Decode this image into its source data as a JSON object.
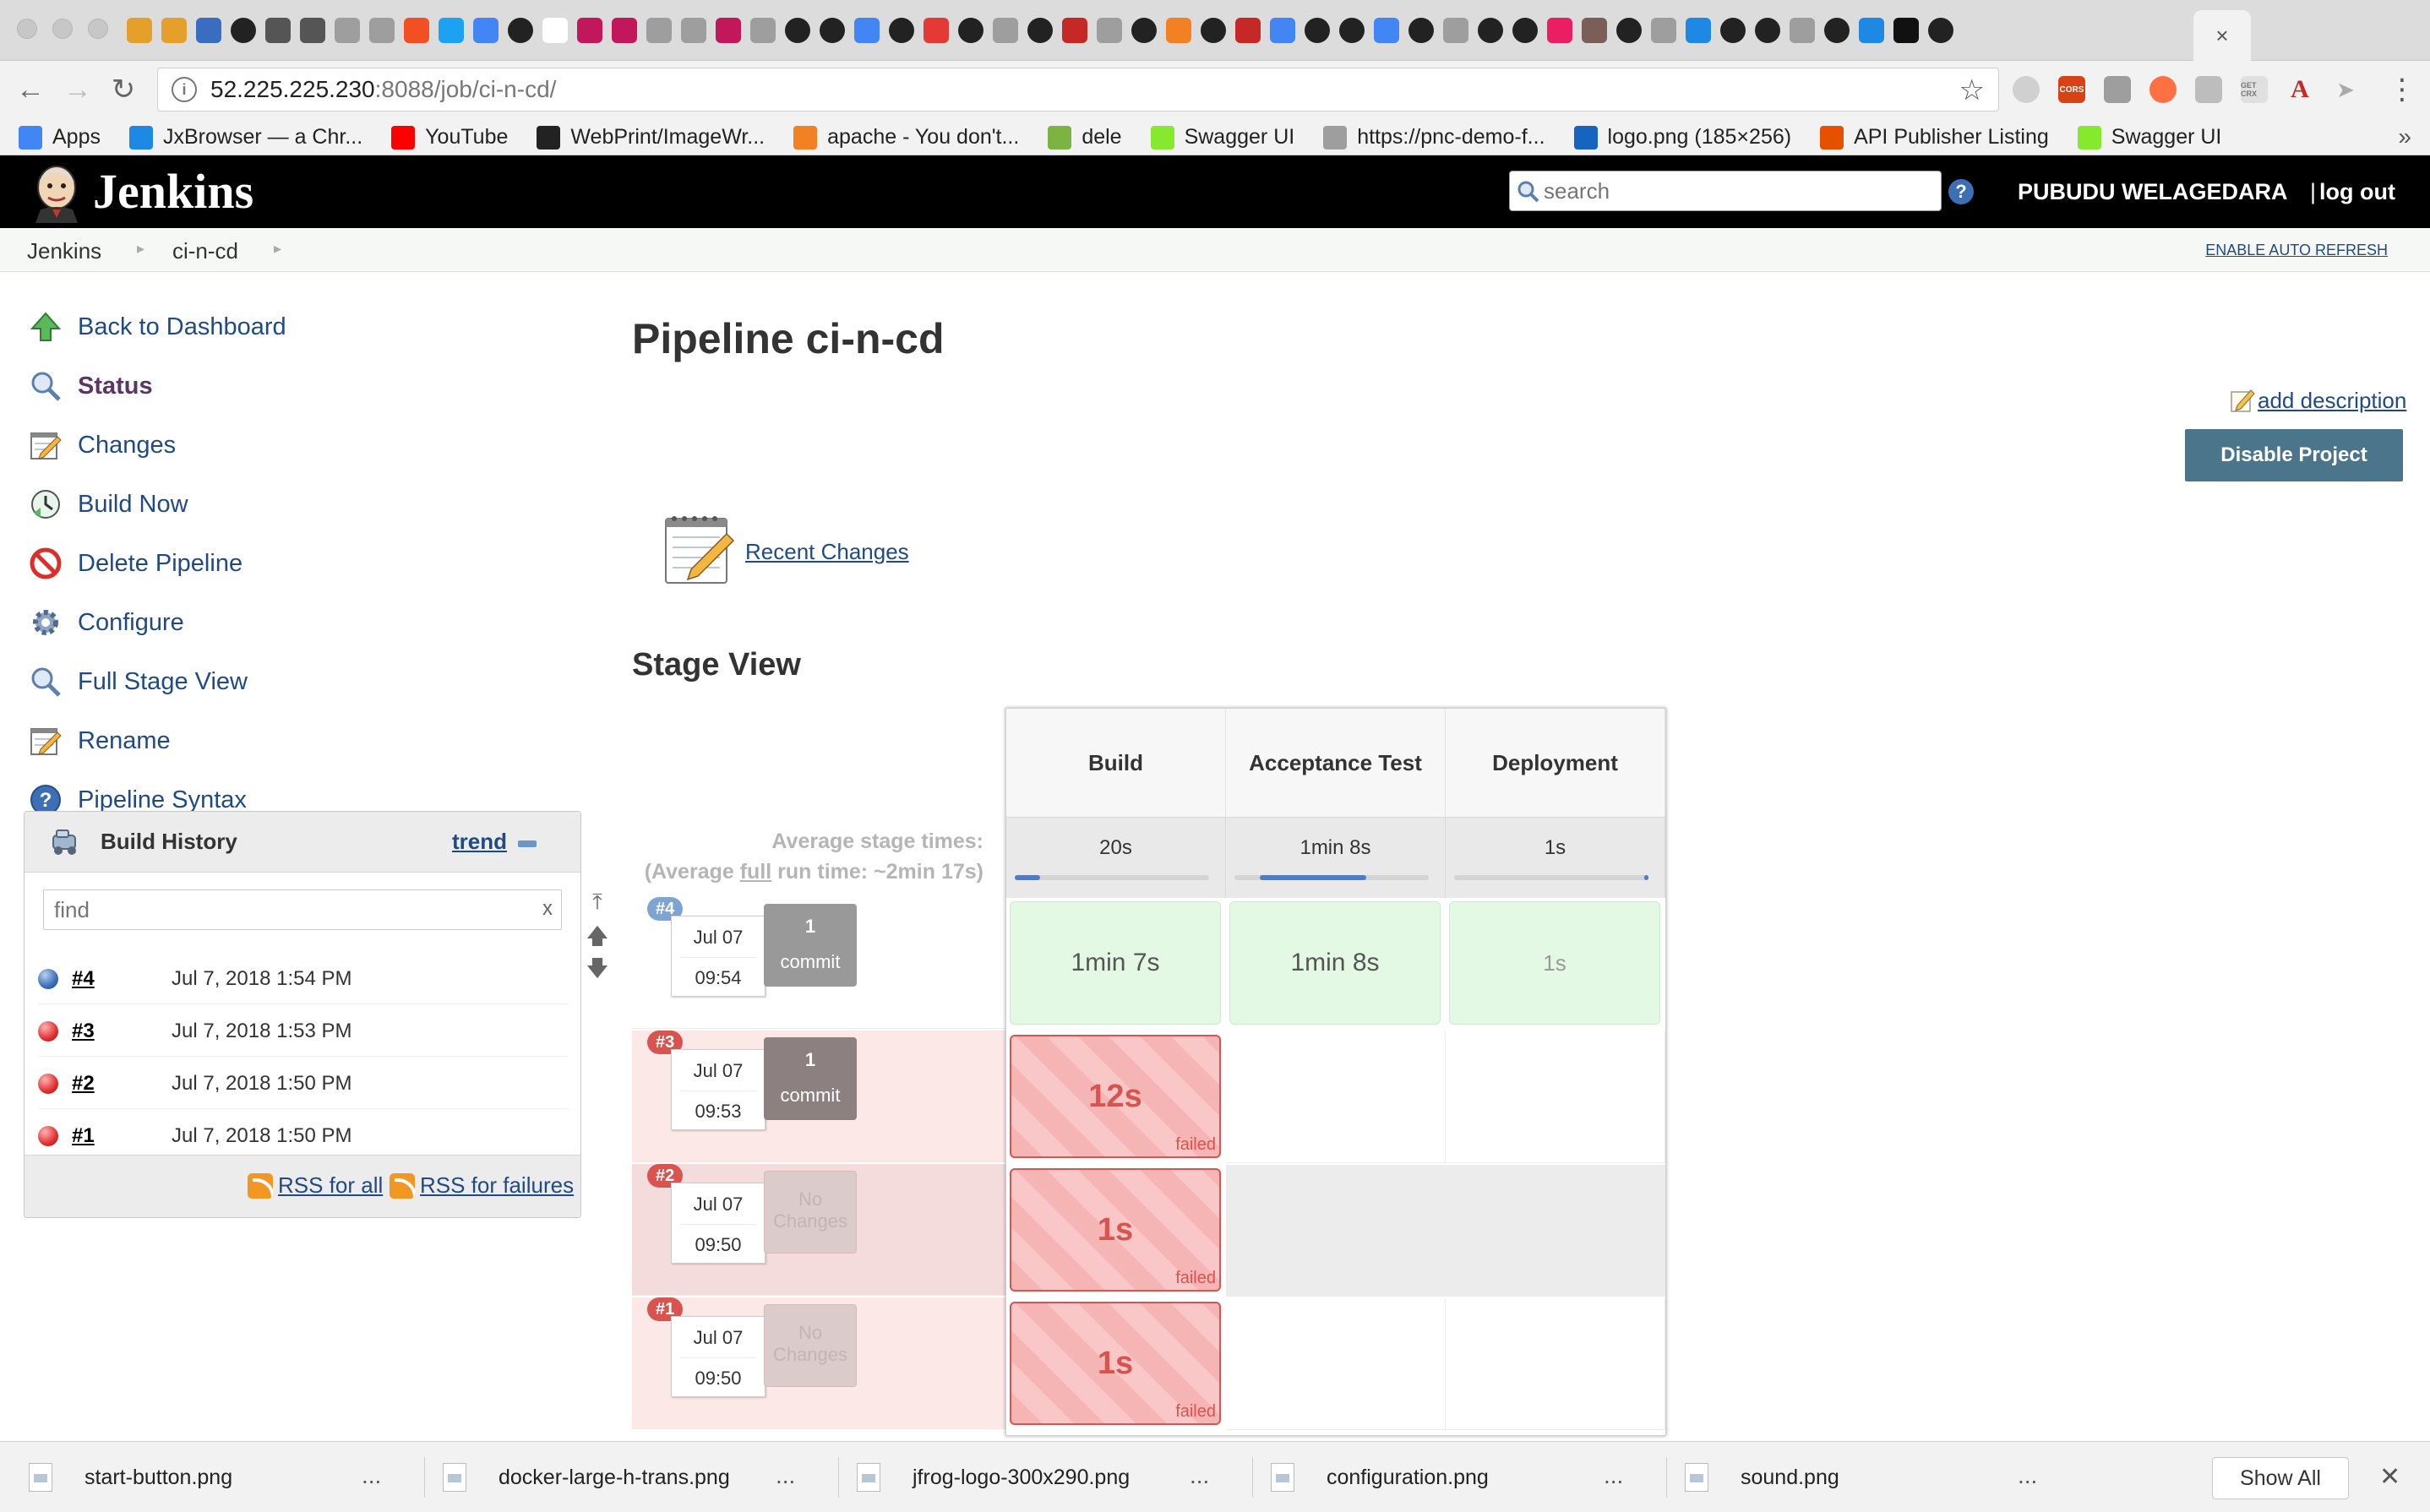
{
  "browser": {
    "url_host": "52.225.225.230",
    "url_rest": ":8088/job/ci-n-cd/",
    "tab_close": "×",
    "bookmarks": [
      {
        "label": "Apps",
        "icon": "apps-grid-icon",
        "color": "#4285f4"
      },
      {
        "label": "JxBrowser — a Chr...",
        "icon": "jxbrowser-icon",
        "color": "#1e88e5"
      },
      {
        "label": "YouTube",
        "icon": "youtube-icon",
        "color": "#ff0000"
      },
      {
        "label": "WebPrint/ImageWr...",
        "icon": "github-icon",
        "color": "#222222"
      },
      {
        "label": "apache - You don't...",
        "icon": "stackoverflow-icon",
        "color": "#f48024"
      },
      {
        "label": "dele",
        "icon": "note-icon",
        "color": "#7cb342"
      },
      {
        "label": "Swagger UI",
        "icon": "swagger-icon",
        "color": "#85ea2d"
      },
      {
        "label": "https://pnc-demo-f...",
        "icon": "page-icon",
        "color": "#9e9e9e"
      },
      {
        "label": "logo.png (185×256)",
        "icon": "x-logo-icon",
        "color": "#1565c0"
      },
      {
        "label": "API Publisher Listing",
        "icon": "api-publisher-icon",
        "color": "#e65100"
      },
      {
        "label": "Swagger UI",
        "icon": "swagger-icon",
        "color": "#85ea2d"
      }
    ]
  },
  "header": {
    "brand": "Jenkins",
    "search_placeholder": "search",
    "user": "PUBUDU WELAGEDARA",
    "logout": "log out",
    "help": "?"
  },
  "breadcrumb": {
    "items": [
      "Jenkins",
      "ci-n-cd"
    ],
    "auto_refresh": "ENABLE AUTO REFRESH"
  },
  "sidebar": {
    "tasks": [
      {
        "label": "Back to Dashboard",
        "icon": "up-arrow-icon"
      },
      {
        "label": "Status",
        "icon": "search-icon"
      },
      {
        "label": "Changes",
        "icon": "notepad-icon"
      },
      {
        "label": "Build Now",
        "icon": "clock-icon"
      },
      {
        "label": "Delete Pipeline",
        "icon": "no-entry-icon"
      },
      {
        "label": "Configure",
        "icon": "gear-icon"
      },
      {
        "label": "Full Stage View",
        "icon": "search-icon"
      },
      {
        "label": "Rename",
        "icon": "notepad-icon"
      },
      {
        "label": "Pipeline Syntax",
        "icon": "help-icon"
      }
    ]
  },
  "build_history": {
    "title": "Build History",
    "trend": "trend",
    "find_placeholder": "find",
    "clear": "x",
    "builds": [
      {
        "number": "#4",
        "date": "Jul 7, 2018 1:54 PM",
        "status": "success"
      },
      {
        "number": "#3",
        "date": "Jul 7, 2018 1:53 PM",
        "status": "failed"
      },
      {
        "number": "#2",
        "date": "Jul 7, 2018 1:50 PM",
        "status": "failed"
      },
      {
        "number": "#1",
        "date": "Jul 7, 2018 1:50 PM",
        "status": "failed"
      }
    ],
    "rss_all": "RSS for all",
    "rss_failures": "RSS for failures"
  },
  "main": {
    "title": "Pipeline ci-n-cd",
    "add_description": "add description",
    "disable_button": "Disable Project",
    "recent_changes": "Recent Changes",
    "stage_view_title": "Stage View"
  },
  "stage_view": {
    "avg_label_1": "Average stage times:",
    "avg_label_2a": "(Average ",
    "avg_label_2b": "full",
    "avg_label_2c": " run time: ~2min 17s)",
    "stages": [
      {
        "name": "Build",
        "avg": "20s",
        "bar_start": 0.0,
        "bar_fill": 0.13
      },
      {
        "name": "Acceptance Test",
        "avg": "1min 8s",
        "bar_start": 0.13,
        "bar_fill": 0.55
      },
      {
        "name": "Deployment",
        "avg": "1s",
        "bar_start": 0.98,
        "bar_fill": 0.02
      }
    ],
    "runs": [
      {
        "id": "#4",
        "date": "Jul 07",
        "time": "09:54",
        "changes_a": "1",
        "changes_b": "commit",
        "has_changes": true,
        "status": "success",
        "cells": [
          {
            "text": "1min 7s",
            "state": "success"
          },
          {
            "text": "1min 8s",
            "state": "success"
          },
          {
            "text": "1s",
            "state": "success"
          }
        ]
      },
      {
        "id": "#3",
        "date": "Jul 07",
        "time": "09:53",
        "changes_a": "1",
        "changes_b": "commit",
        "has_changes": true,
        "status": "failed",
        "cells": [
          {
            "text": "12s",
            "state": "failed",
            "label": "failed"
          },
          {
            "text": "",
            "state": "empty"
          },
          {
            "text": "",
            "state": "empty"
          }
        ]
      },
      {
        "id": "#2",
        "date": "Jul 07",
        "time": "09:50",
        "changes_a": "No",
        "changes_b": "Changes",
        "has_changes": false,
        "status": "failed",
        "cells": [
          {
            "text": "1s",
            "state": "failed",
            "label": "failed"
          },
          {
            "text": "",
            "state": "empty"
          },
          {
            "text": "",
            "state": "empty"
          }
        ]
      },
      {
        "id": "#1",
        "date": "Jul 07",
        "time": "09:50",
        "changes_a": "No",
        "changes_b": "Changes",
        "has_changes": false,
        "status": "failed",
        "cells": [
          {
            "text": "1s",
            "state": "failed",
            "label": "failed"
          },
          {
            "text": "",
            "state": "empty"
          },
          {
            "text": "",
            "state": "empty"
          }
        ]
      }
    ]
  },
  "downloads": {
    "files": [
      "start-button.png",
      "docker-large-h-trans.png",
      "jfrog-logo-300x290.png",
      "configuration.png",
      "sound.png"
    ],
    "more": "...",
    "show_all": "Show All",
    "close": "✕"
  }
}
